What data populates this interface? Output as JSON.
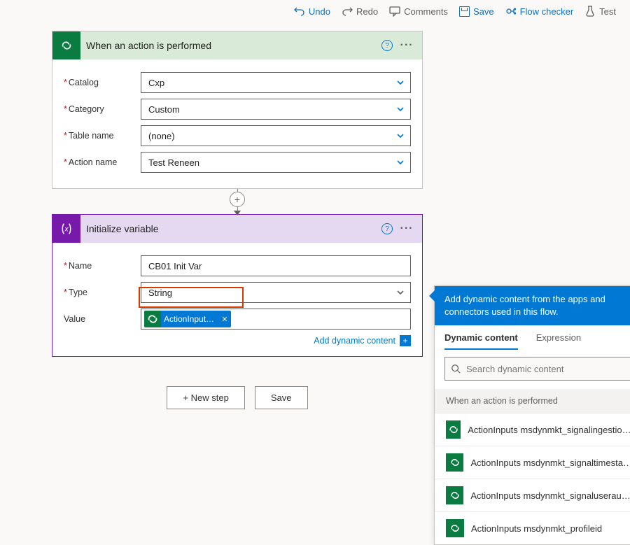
{
  "toolbar": {
    "undo": "Undo",
    "redo": "Redo",
    "comments": "Comments",
    "save": "Save",
    "flow_checker": "Flow checker",
    "test": "Test"
  },
  "trigger": {
    "title": "When an action is performed",
    "fields": {
      "catalog": {
        "label": "Catalog",
        "value": "Cxp"
      },
      "category": {
        "label": "Category",
        "value": "Custom"
      },
      "table": {
        "label": "Table name",
        "value": "(none)"
      },
      "action": {
        "label": "Action name",
        "value": "Test Reneen"
      }
    }
  },
  "action": {
    "title": "Initialize variable",
    "fields": {
      "name": {
        "label": "Name",
        "value": "CB01 Init Var"
      },
      "type": {
        "label": "Type",
        "value": "String"
      },
      "value": {
        "label": "Value",
        "token": "ActionInputs m..."
      }
    },
    "add_dynamic_label": "Add dynamic content"
  },
  "footer": {
    "new_step": "+ New step",
    "save": "Save"
  },
  "dc_panel": {
    "hint": "Add dynamic content from the apps and connectors used in this flow.",
    "tab_dynamic": "Dynamic content",
    "tab_expression": "Expression",
    "search_placeholder": "Search dynamic content",
    "group_title": "When an action is performed",
    "items": [
      "ActionInputs msdynmkt_signalingestiontimestamp",
      "ActionInputs msdynmkt_signaltimestamp",
      "ActionInputs msdynmkt_signaluserauthid",
      "ActionInputs msdynmkt_profileid"
    ]
  }
}
